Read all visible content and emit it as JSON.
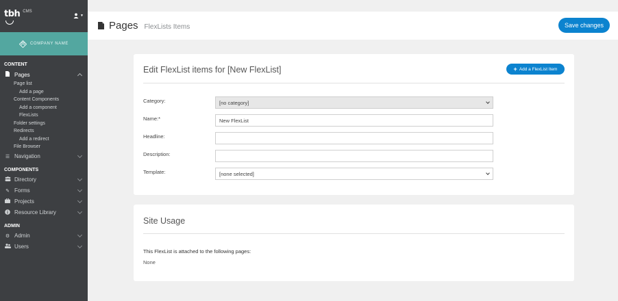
{
  "sidebar": {
    "logo": "tbh",
    "logo_suffix": "CMS",
    "company": "COMPANY NAME",
    "sections": {
      "content": "CONTENT",
      "components": "COMPONENTS",
      "admin": "ADMIN"
    },
    "items": {
      "pages": "Pages",
      "page_list": "Page list",
      "add_page": "Add a page",
      "content_components": "Content Components",
      "add_component": "Add a component",
      "flexlists": "FlexLists",
      "folder_settings": "Folder settings",
      "redirects": "Redirects",
      "add_redirect": "Add a redirect",
      "file_browser": "File Browser",
      "navigation": "Navigation",
      "directory": "Directory",
      "forms": "Forms",
      "projects": "Projects",
      "resource_library": "Resource Library",
      "admin": "Admin",
      "users": "Users"
    }
  },
  "header": {
    "title": "Pages",
    "subtitle": "FlexLists Items",
    "save_label": "Save changes"
  },
  "edit_card": {
    "title": "Edit FlexList items for [New FlexList]",
    "add_label": "Add a FlexList Item",
    "fields": {
      "category_label": "Category:",
      "category_value": "[no category]",
      "name_label": "Name:*",
      "name_value": "New FlexList",
      "headline_label": "Headline:",
      "headline_value": "",
      "description_label": "Description:",
      "description_value": "",
      "template_label": "Template:",
      "template_value": "[none selected]"
    }
  },
  "usage_card": {
    "title": "Site Usage",
    "text": "This FlexList is attached to the following pages:",
    "none": "None"
  },
  "colors": {
    "sidebar_bg": "#3d3f42",
    "brand_teal": "#53a7a0",
    "primary_blue": "#0c83cf"
  }
}
